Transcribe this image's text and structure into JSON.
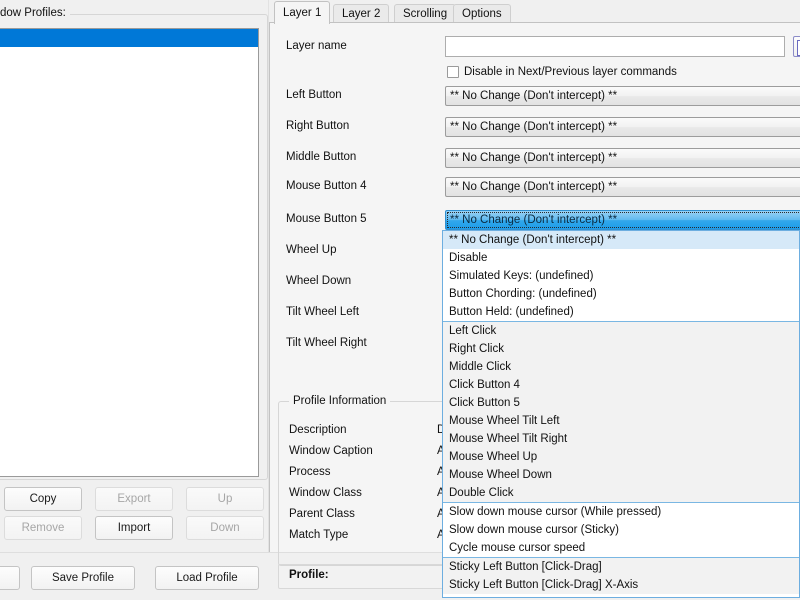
{
  "left_panel": {
    "group_label": "dow Profiles:",
    "profiles": [
      {
        "label": "",
        "selected": true
      },
      {
        "label": "",
        "selected": false
      },
      {
        "label": "",
        "selected": false
      }
    ],
    "buttons": {
      "copy": "Copy",
      "export": "Export",
      "up": "Up",
      "remove": "Remove",
      "import": "Import",
      "down": "Down"
    }
  },
  "bottom_bar": {
    "partial_left": "",
    "save_profile": "Save Profile",
    "load_profile": "Load Profile",
    "profile_label": "Profile:"
  },
  "tabs": [
    {
      "label": "Layer 1",
      "active": true
    },
    {
      "label": "Layer 2",
      "active": false
    },
    {
      "label": "Scrolling",
      "active": false
    },
    {
      "label": "Options",
      "active": false
    }
  ],
  "layer_tab": {
    "layer_name_label": "Layer name",
    "layer_name_value": "",
    "layer_name_placeholder": "",
    "disable_next_prev_label": "Disable in Next/Previous layer commands",
    "disable_next_prev_checked": false,
    "no_change_value": "** No Change (Don't intercept) **",
    "bindings": [
      {
        "label": "Left Button",
        "value": "** No Change (Don't intercept) **",
        "focused": false
      },
      {
        "label": "Right Button",
        "value": "** No Change (Don't intercept) **",
        "focused": false
      },
      {
        "label": "Middle Button",
        "value": "** No Change (Don't intercept) **",
        "focused": false
      },
      {
        "label": "Mouse Button 4",
        "value": "** No Change (Don't intercept) **",
        "focused": false
      },
      {
        "label": "Mouse Button 5",
        "value": "** No Change (Don't intercept) **",
        "focused": true
      },
      {
        "label": "Wheel Up",
        "value": "",
        "focused": false
      },
      {
        "label": "Wheel Down",
        "value": "",
        "focused": false
      },
      {
        "label": "Tilt Wheel Left",
        "value": "",
        "focused": false
      },
      {
        "label": "Tilt Wheel Right",
        "value": "",
        "focused": false
      }
    ]
  },
  "profile_information": {
    "group_label": "Profile Information",
    "rows": [
      {
        "key": "Description",
        "value": "Defa"
      },
      {
        "key": "Window Caption",
        "value": "All"
      },
      {
        "key": "Process",
        "value": "All"
      },
      {
        "key": "Window Class",
        "value": "All"
      },
      {
        "key": "Parent Class",
        "value": "All"
      },
      {
        "key": "Match Type",
        "value": "All"
      }
    ]
  },
  "dropdown": {
    "open_for": "Mouse Button 5",
    "highlighted_index": 0,
    "groups": [
      {
        "shaded": false,
        "items": [
          "** No Change (Don't intercept) **",
          "Disable",
          "Simulated Keys: (undefined)",
          "Button Chording: (undefined)",
          "Button Held: (undefined)"
        ]
      },
      {
        "shaded": true,
        "items": [
          "Left Click",
          "Right Click",
          "Middle Click",
          "Click Button 4",
          "Click Button 5",
          "Mouse Wheel Tilt Left",
          "Mouse Wheel Tilt Right",
          "Mouse Wheel Up",
          "Mouse Wheel Down",
          "Double Click"
        ]
      },
      {
        "shaded": false,
        "items": [
          "Slow down mouse cursor (While pressed)",
          "Slow down mouse cursor (Sticky)",
          "Cycle mouse cursor speed"
        ]
      },
      {
        "shaded": true,
        "items": [
          "Sticky Left Button [Click-Drag]",
          "Sticky Left Button [Click-Drag] X-Axis"
        ]
      }
    ]
  },
  "colors": {
    "selection_blue": "#0078d7",
    "dropdown_border": "#6daee0",
    "dropdown_highlight": "#d6e9f8",
    "group_separator": "#7ab7e3",
    "window_background": "#f0f0f0",
    "panel_background": "#f5f5f5"
  }
}
